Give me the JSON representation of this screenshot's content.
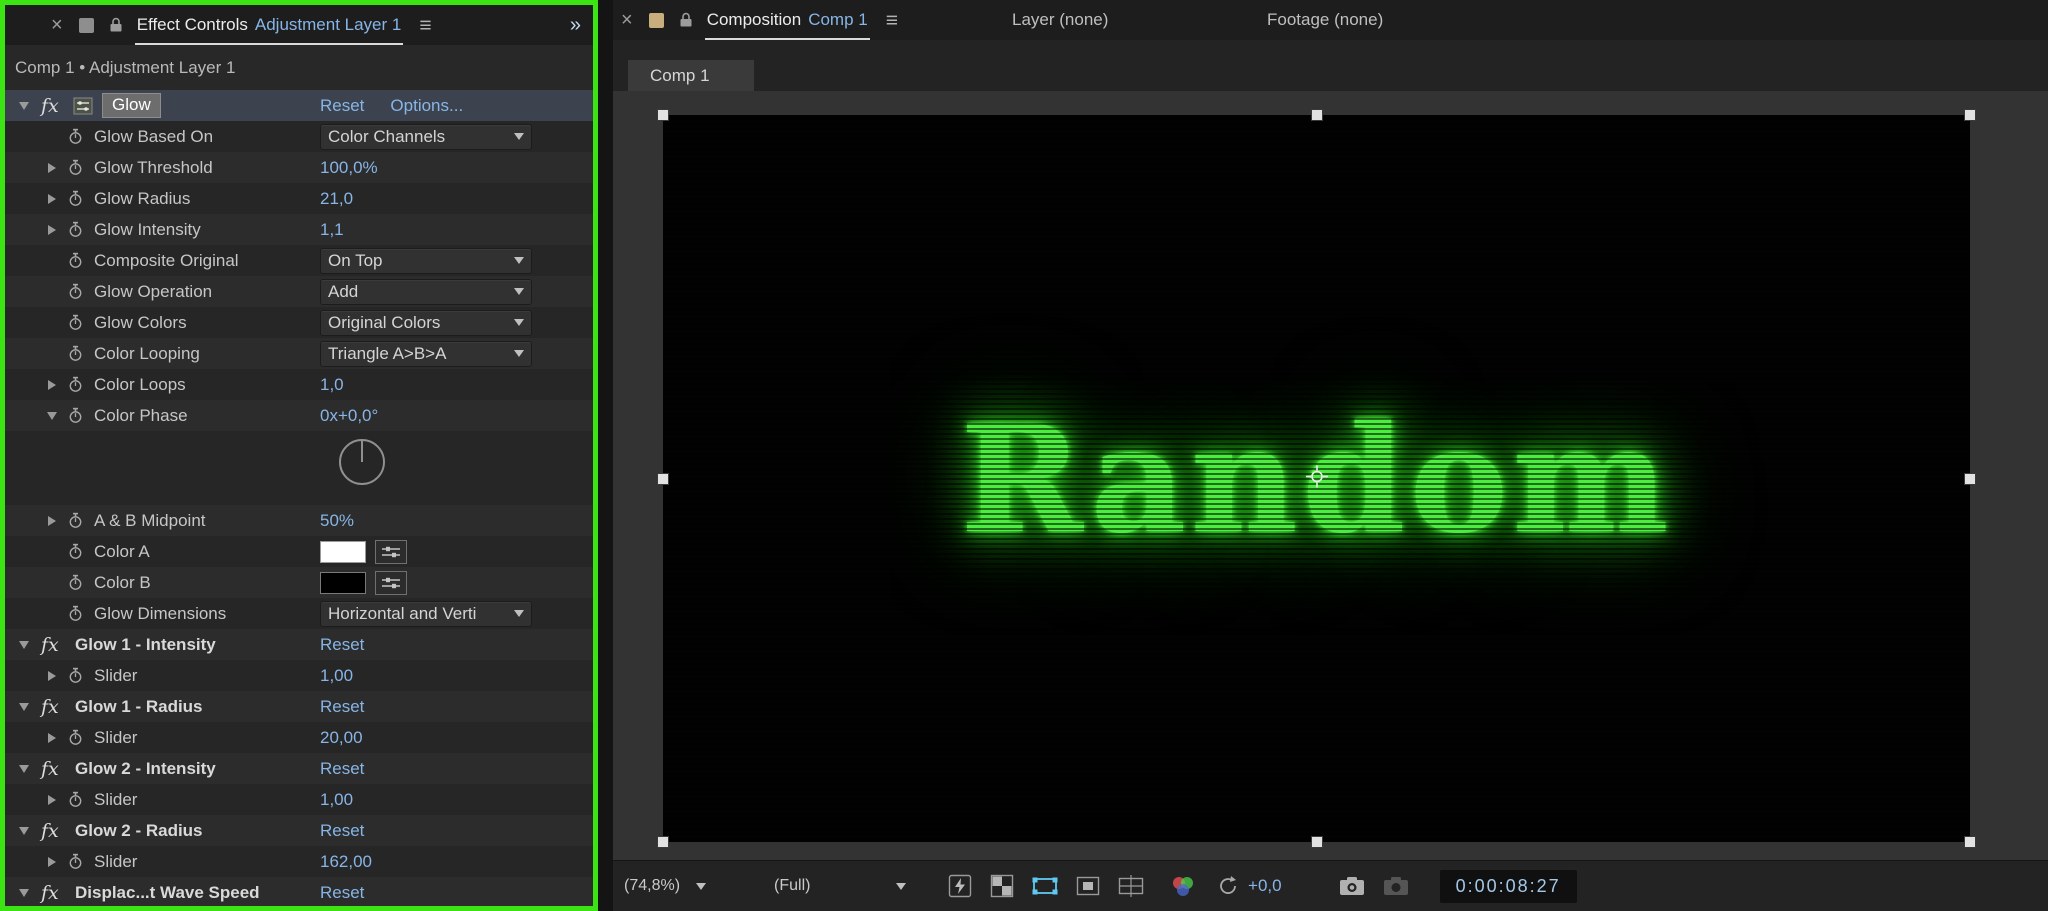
{
  "colors": {
    "accent_blue": "#87b5e6",
    "selection_frame_green": "#3ce414",
    "glow_text_green": "#4aee3d",
    "color_a_swatch": "#ffffff",
    "color_b_swatch": "#000000"
  },
  "effect_controls": {
    "tabbar": {
      "close": "×",
      "title": "Effect Controls",
      "target": "Adjustment Layer 1",
      "menu": "≡",
      "overflow": "»"
    },
    "breadcrumb": "Comp 1 • Adjustment Layer 1",
    "header": {
      "name": "Glow",
      "reset": "Reset",
      "options": "Options..."
    },
    "rows": [
      {
        "label": "Glow Based On",
        "value": "Color Channels"
      },
      {
        "label": "Glow Threshold",
        "value": "100,0%"
      },
      {
        "label": "Glow Radius",
        "value": "21,0"
      },
      {
        "label": "Glow Intensity",
        "value": "1,1"
      },
      {
        "label": "Composite Original",
        "value": "On Top"
      },
      {
        "label": "Glow Operation",
        "value": "Add"
      },
      {
        "label": "Glow Colors",
        "value": "Original Colors"
      },
      {
        "label": "Color Looping",
        "value": "Triangle A>B>A"
      },
      {
        "label": "Color Loops",
        "value": "1,0"
      },
      {
        "label": "Color Phase",
        "value": "0x+0,0°"
      },
      {
        "label": "A & B Midpoint",
        "value": "50%"
      },
      {
        "label": "Color A"
      },
      {
        "label": "Color B"
      },
      {
        "label": "Glow Dimensions",
        "value": "Horizontal and Verti"
      },
      {
        "label": "Glow 1 - Intensity",
        "value": "Reset"
      },
      {
        "label": "Slider",
        "value": "1,00"
      },
      {
        "label": "Glow 1 - Radius",
        "value": "Reset"
      },
      {
        "label": "Slider",
        "value": "20,00"
      },
      {
        "label": "Glow 2 - Intensity",
        "value": "Reset"
      },
      {
        "label": "Slider",
        "value": "1,00"
      },
      {
        "label": "Glow 2 - Radius",
        "value": "Reset"
      },
      {
        "label": "Slider",
        "value": "162,00"
      },
      {
        "label": "Displac...t Wave Speed",
        "value": "Reset"
      }
    ]
  },
  "composition": {
    "tabbar": {
      "close": "×",
      "title": "Composition",
      "target": "Comp 1",
      "menu": "≡",
      "layer_tab": "Layer (none)",
      "footage_tab": "Footage (none)"
    },
    "viewer_tab": "Comp 1",
    "canvas_text": "Random",
    "toolbar": {
      "zoom": "(74,8%)",
      "resolution": "(Full)",
      "exposure": "+0,0",
      "timecode": "0:00:08:27"
    }
  }
}
